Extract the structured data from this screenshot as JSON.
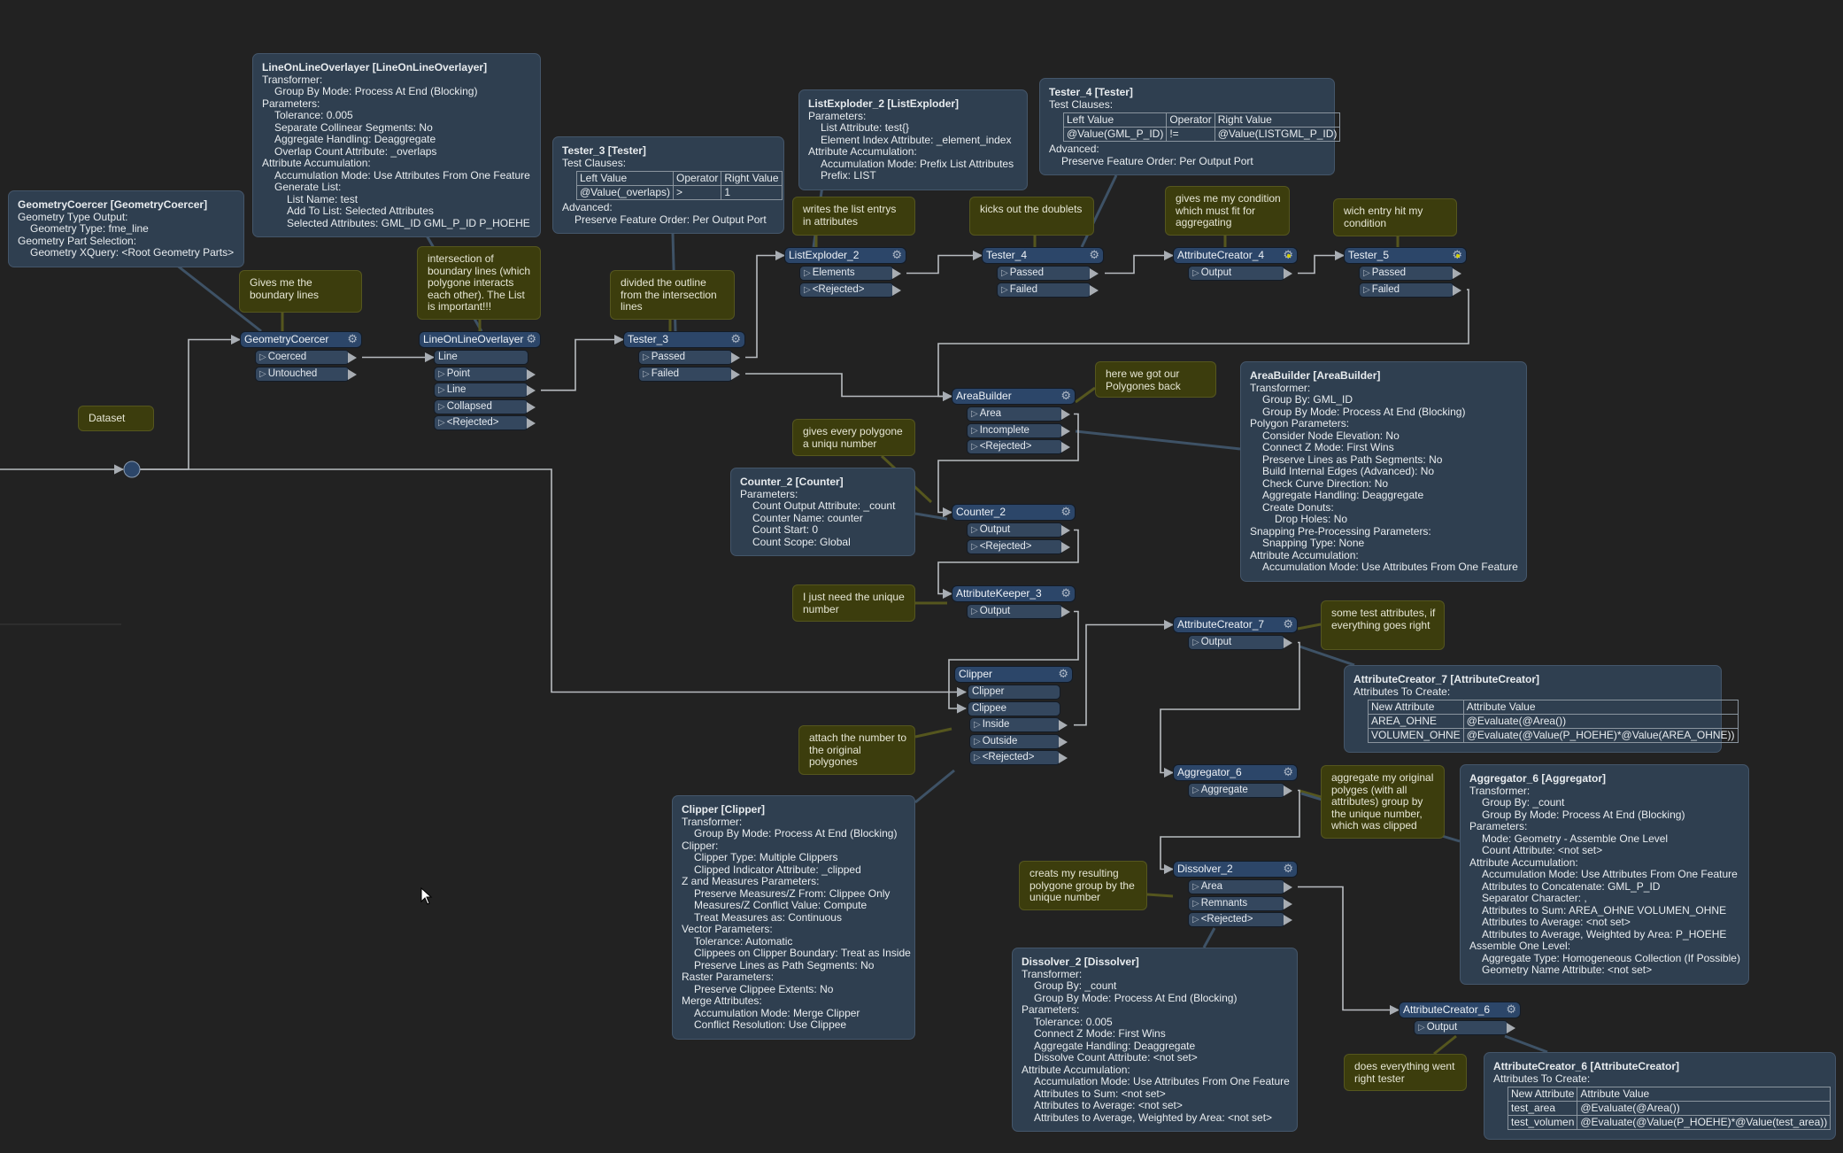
{
  "canvas": {
    "background": "#222222",
    "wire_color": "#b8bcc0",
    "header_color": "#2c4669",
    "port_color": "#34475e",
    "note_color": "#3c3d0d",
    "annotation_color": "#2f3f50",
    "modified_gear_color": "#d6d000"
  },
  "nodes": [
    {
      "id": "geometrycoercer",
      "name": "GeometryCoercer",
      "gear": "gear-icon",
      "inputs": [],
      "outputs": [
        "Coerced",
        "Untouched"
      ]
    },
    {
      "id": "lineonlineoverlayer",
      "name": "LineOnLineOverlayer",
      "gear": "gear-icon",
      "inputs": [
        "Line"
      ],
      "outputs": [
        "Point",
        "Line",
        "Collapsed",
        "<Rejected>"
      ]
    },
    {
      "id": "tester3",
      "name": "Tester_3",
      "gear": "gear-icon",
      "inputs": [],
      "outputs": [
        "Passed",
        "Failed"
      ]
    },
    {
      "id": "listexploder2",
      "name": "ListExploder_2",
      "gear": "gear-icon",
      "inputs": [],
      "outputs": [
        "Elements",
        "<Rejected>"
      ]
    },
    {
      "id": "tester4",
      "name": "Tester_4",
      "gear": "gear-icon",
      "inputs": [],
      "outputs": [
        "Passed",
        "Failed"
      ]
    },
    {
      "id": "attributecreator4",
      "name": "AttributeCreator_4",
      "gear": "gear-modified-icon",
      "inputs": [],
      "outputs": [
        "Output"
      ]
    },
    {
      "id": "tester5",
      "name": "Tester_5",
      "gear": "gear-modified-icon",
      "inputs": [],
      "outputs": [
        "Passed",
        "Failed"
      ]
    },
    {
      "id": "areabuilder",
      "name": "AreaBuilder",
      "gear": "gear-icon",
      "inputs": [],
      "outputs": [
        "Area",
        "Incomplete",
        "<Rejected>"
      ]
    },
    {
      "id": "counter2",
      "name": "Counter_2",
      "gear": "gear-icon",
      "inputs": [],
      "outputs": [
        "Output",
        "<Rejected>"
      ]
    },
    {
      "id": "attributekeeper3",
      "name": "AttributeKeeper_3",
      "gear": "gear-icon",
      "inputs": [],
      "outputs": [
        "Output"
      ]
    },
    {
      "id": "attributecreator7",
      "name": "AttributeCreator_7",
      "gear": "gear-icon",
      "inputs": [],
      "outputs": [
        "Output"
      ]
    },
    {
      "id": "clipper",
      "name": "Clipper",
      "gear": "gear-icon",
      "inputs": [
        "Clipper",
        "Clippee"
      ],
      "outputs": [
        "Inside",
        "Outside",
        "<Rejected>"
      ]
    },
    {
      "id": "aggregator6",
      "name": "Aggregator_6",
      "gear": "gear-icon",
      "inputs": [],
      "outputs": [
        "Aggregate"
      ]
    },
    {
      "id": "dissolver2",
      "name": "Dissolver_2",
      "gear": "gear-icon",
      "inputs": [],
      "outputs": [
        "Area",
        "Remnants",
        "<Rejected>"
      ]
    },
    {
      "id": "attributecreator6",
      "name": "AttributeCreator_6",
      "gear": "gear-icon",
      "inputs": [],
      "outputs": [
        "Output"
      ]
    }
  ],
  "annotations": [
    {
      "id": "geometrycoercer",
      "title": "GeometryCoercer [GeometryCoercer]",
      "content": [
        {
          "text": "Geometry Type Output:",
          "level": 0
        },
        {
          "text": "Geometry Type: fme_line",
          "level": 1
        },
        {
          "text": "Geometry Part Selection:",
          "level": 0
        },
        {
          "text": "Geometry XQuery: <Root Geometry Parts>",
          "level": 1
        }
      ]
    },
    {
      "id": "lineonlineoverlayer",
      "title": "LineOnLineOverlayer [LineOnLineOverlayer]",
      "content": [
        {
          "text": "Transformer:",
          "level": 0
        },
        {
          "text": "Group By Mode: Process At End (Blocking)",
          "level": 1
        },
        {
          "text": "Parameters:",
          "level": 0
        },
        {
          "text": "Tolerance: 0.005",
          "level": 1
        },
        {
          "text": "Separate Collinear Segments: No",
          "level": 1
        },
        {
          "text": "Aggregate Handling: Deaggregate",
          "level": 1
        },
        {
          "text": "Overlap Count Attribute: _overlaps",
          "level": 1
        },
        {
          "text": "Attribute Accumulation:",
          "level": 0
        },
        {
          "text": "Accumulation Mode: Use Attributes From One Feature",
          "level": 1
        },
        {
          "text": "Generate List:",
          "level": 1
        },
        {
          "text": "List Name: test",
          "level": 2
        },
        {
          "text": "Add To List: Selected Attributes",
          "level": 2
        },
        {
          "text": "Selected Attributes: GML_ID GML_P_ID P_HOEHE",
          "level": 2
        }
      ]
    },
    {
      "id": "tester3",
      "title": "Tester_3 [Tester]",
      "content": [
        {
          "text": "Test Clauses:",
          "level": 0
        },
        {
          "table": {
            "header": [
              "Left Value",
              "Operator",
              "Right Value"
            ],
            "rows": [
              [
                "@Value(_overlaps)",
                ">",
                "1"
              ]
            ]
          }
        },
        {
          "text": "Advanced:",
          "level": 0
        },
        {
          "text": "Preserve Feature Order: Per Output Port",
          "level": 1
        }
      ]
    },
    {
      "id": "listexploder2",
      "title": "ListExploder_2 [ListExploder]",
      "content": [
        {
          "text": "Parameters:",
          "level": 0
        },
        {
          "text": "List Attribute: test{}",
          "level": 1
        },
        {
          "text": "Element Index Attribute: _element_index",
          "level": 1
        },
        {
          "text": "Attribute Accumulation:",
          "level": 0
        },
        {
          "text": "Accumulation Mode: Prefix List Attributes",
          "level": 1
        },
        {
          "text": "Prefix: LIST",
          "level": 1
        }
      ]
    },
    {
      "id": "tester4",
      "title": "Tester_4 [Tester]",
      "content": [
        {
          "text": "Test Clauses:",
          "level": 0
        },
        {
          "table": {
            "header": [
              "Left Value",
              "Operator",
              "Right Value"
            ],
            "rows": [
              [
                "@Value(GML_P_ID)",
                "!=",
                "@Value(LISTGML_P_ID)"
              ]
            ]
          }
        },
        {
          "text": "Advanced:",
          "level": 0
        },
        {
          "text": "Preserve Feature Order: Per Output Port",
          "level": 1
        }
      ]
    },
    {
      "id": "areabuilder",
      "title": "AreaBuilder [AreaBuilder]",
      "content": [
        {
          "text": "Transformer:",
          "level": 0
        },
        {
          "text": "Group By: GML_ID",
          "level": 1
        },
        {
          "text": "Group By Mode: Process At End (Blocking)",
          "level": 1
        },
        {
          "text": "Polygon Parameters:",
          "level": 0
        },
        {
          "text": "Consider Node Elevation: No",
          "level": 1
        },
        {
          "text": "Connect Z Mode: First Wins",
          "level": 1
        },
        {
          "text": "Preserve Lines as Path Segments: No",
          "level": 1
        },
        {
          "text": "Build Internal Edges (Advanced): No",
          "level": 1
        },
        {
          "text": "Check Curve Direction: No",
          "level": 1
        },
        {
          "text": "Aggregate Handling: Deaggregate",
          "level": 1
        },
        {
          "text": "Create Donuts:",
          "level": 1
        },
        {
          "text": "Drop Holes: No",
          "level": 2
        },
        {
          "text": "Snapping Pre-Processing Parameters:",
          "level": 0
        },
        {
          "text": "Snapping Type: None",
          "level": 1
        },
        {
          "text": "Attribute Accumulation:",
          "level": 0
        },
        {
          "text": "Accumulation Mode: Use Attributes From One Feature",
          "level": 1
        }
      ]
    },
    {
      "id": "counter2",
      "title": "Counter_2 [Counter]",
      "content": [
        {
          "text": "Parameters:",
          "level": 0
        },
        {
          "text": "Count Output Attribute: _count",
          "level": 1
        },
        {
          "text": "Counter Name: counter",
          "level": 1
        },
        {
          "text": "Count Start: 0",
          "level": 1
        },
        {
          "text": "Count Scope: Global",
          "level": 1
        }
      ]
    },
    {
      "id": "attributecreator7",
      "title": "AttributeCreator_7 [AttributeCreator]",
      "content": [
        {
          "text": "Attributes To Create:",
          "level": 0
        },
        {
          "table": {
            "header": [
              "New Attribute",
              "Attribute Value"
            ],
            "rows": [
              [
                "AREA_OHNE",
                "@Evaluate(@Area())"
              ],
              [
                "VOLUMEN_OHNE",
                "@Evaluate(@Value(P_HOEHE)*@Value(AREA_OHNE))"
              ]
            ]
          }
        }
      ]
    },
    {
      "id": "clipper",
      "title": "Clipper [Clipper]",
      "content": [
        {
          "text": "Transformer:",
          "level": 0
        },
        {
          "text": "Group By Mode: Process At End (Blocking)",
          "level": 1
        },
        {
          "text": "Clipper:",
          "level": 0
        },
        {
          "text": "Clipper Type: Multiple Clippers",
          "level": 1
        },
        {
          "text": "Clipped Indicator Attribute: _clipped",
          "level": 1
        },
        {
          "text": "Z and Measures Parameters:",
          "level": 0
        },
        {
          "text": "Preserve Measures/Z From: Clippee Only",
          "level": 1
        },
        {
          "text": "Measures/Z Conflict Value: Compute",
          "level": 1
        },
        {
          "text": "Treat Measures as: Continuous",
          "level": 1
        },
        {
          "text": "Vector Parameters:",
          "level": 0
        },
        {
          "text": "Tolerance: Automatic",
          "level": 1
        },
        {
          "text": "Clippees on Clipper Boundary: Treat as Inside",
          "level": 1
        },
        {
          "text": "Preserve Lines as Path Segments: No",
          "level": 1
        },
        {
          "text": "Raster Parameters:",
          "level": 0
        },
        {
          "text": "Preserve Clippee Extents: No",
          "level": 1
        },
        {
          "text": "Merge Attributes:",
          "level": 0
        },
        {
          "text": "Accumulation Mode: Merge Clipper",
          "level": 1
        },
        {
          "text": "Conflict Resolution: Use Clippee",
          "level": 1
        }
      ]
    },
    {
      "id": "aggregator6",
      "title": "Aggregator_6 [Aggregator]",
      "content": [
        {
          "text": "Transformer:",
          "level": 0
        },
        {
          "text": "Group By: _count",
          "level": 1
        },
        {
          "text": "Group By Mode: Process At End (Blocking)",
          "level": 1
        },
        {
          "text": "Parameters:",
          "level": 0
        },
        {
          "text": "Mode: Geometry - Assemble One Level",
          "level": 1
        },
        {
          "text": "Count Attribute: <not set>",
          "level": 1
        },
        {
          "text": "Attribute Accumulation:",
          "level": 0
        },
        {
          "text": "Accumulation Mode: Use Attributes From One Feature",
          "level": 1
        },
        {
          "text": "Attributes to Concatenate: GML_P_ID",
          "level": 1
        },
        {
          "text": "Separator Character: ,",
          "level": 1
        },
        {
          "text": "Attributes to Sum: AREA_OHNE VOLUMEN_OHNE",
          "level": 1
        },
        {
          "text": "Attributes to Average: <not set>",
          "level": 1
        },
        {
          "text": "Attributes to Average, Weighted by Area: P_HOEHE",
          "level": 1
        },
        {
          "text": "Assemble One Level:",
          "level": 0
        },
        {
          "text": "Aggregate Type: Homogeneous Collection (If Possible)",
          "level": 1
        },
        {
          "text": "Geometry Name Attribute: <not set>",
          "level": 1
        }
      ]
    },
    {
      "id": "dissolver2",
      "title": "Dissolver_2 [Dissolver]",
      "content": [
        {
          "text": "Transformer:",
          "level": 0
        },
        {
          "text": "Group By: _count",
          "level": 1
        },
        {
          "text": "Group By Mode: Process At End (Blocking)",
          "level": 1
        },
        {
          "text": "Parameters:",
          "level": 0
        },
        {
          "text": "Tolerance: 0.005",
          "level": 1
        },
        {
          "text": "Connect Z Mode: First Wins",
          "level": 1
        },
        {
          "text": "Aggregate Handling: Deaggregate",
          "level": 1
        },
        {
          "text": "Dissolve Count Attribute: <not set>",
          "level": 1
        },
        {
          "text": "Attribute Accumulation:",
          "level": 0
        },
        {
          "text": "Accumulation Mode: Use Attributes From One Feature",
          "level": 1
        },
        {
          "text": "Attributes to Sum: <not set>",
          "level": 1
        },
        {
          "text": "Attributes to Average: <not set>",
          "level": 1
        },
        {
          "text": "Attributes to Average, Weighted by Area: <not set>",
          "level": 1
        }
      ]
    },
    {
      "id": "attributecreator6",
      "title": "AttributeCreator_6 [AttributeCreator]",
      "content": [
        {
          "text": "Attributes To Create:",
          "level": 0
        },
        {
          "table": {
            "header": [
              "New Attribute",
              "Attribute Value"
            ],
            "rows": [
              [
                "test_area",
                "@Evaluate(@Area())"
              ],
              [
                "test_volumen",
                "@Evaluate(@Value(P_HOEHE)*@Value(test_area))"
              ]
            ]
          }
        }
      ]
    }
  ],
  "notes": [
    {
      "id": "boundary",
      "text": "Gives me the boundary lines"
    },
    {
      "id": "intersection",
      "text": "intersection of boundary lines (which polygone interacts each other). The List is important!!!"
    },
    {
      "id": "divided",
      "text": "divided the outline from the intersection lines"
    },
    {
      "id": "writes",
      "text": "writes the list entrys in attributes"
    },
    {
      "id": "kicks",
      "text": "kicks out the doublets"
    },
    {
      "id": "givesme",
      "text": "gives me my condition which must fit for aggregating"
    },
    {
      "id": "wich",
      "text": "wich entry hit my condition"
    },
    {
      "id": "dataset",
      "text": "Dataset"
    },
    {
      "id": "here",
      "text": "here we got our Polygones back"
    },
    {
      "id": "giveseverypolygone",
      "text": "gives every polygone a uniqu number"
    },
    {
      "id": "ijust",
      "text": "I just need the unique number"
    },
    {
      "id": "sometest",
      "text": "some test attributes, if everything goes right"
    },
    {
      "id": "attach",
      "text": "attach the number to the original polygones"
    },
    {
      "id": "aggregate",
      "text": "aggregate my original polyges (with all attributes) group by the unique number, which was clipped"
    },
    {
      "id": "creats",
      "text": "creats my resulting polygone group by the unique number"
    },
    {
      "id": "does",
      "text": "does everything went right tester"
    }
  ]
}
